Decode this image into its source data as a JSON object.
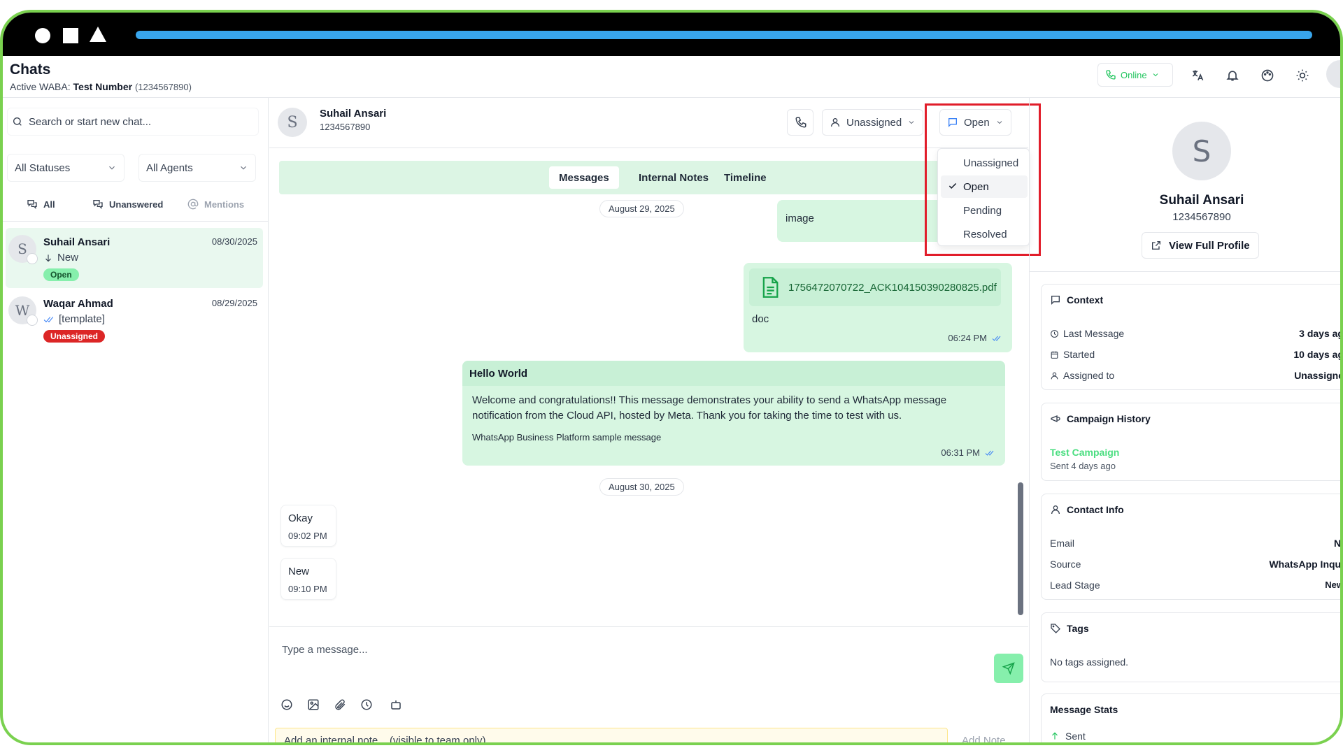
{
  "app": {
    "title": "Chats",
    "active_label": "Active WABA:",
    "active_name": "Test Number",
    "active_number": "(1234567890)",
    "status": "Online"
  },
  "sidebar": {
    "search_placeholder": "Search or start new chat...",
    "status_filter": "All Statuses",
    "agent_filter": "All Agents",
    "tabs": [
      "All",
      "Unanswered",
      "Mentions"
    ],
    "conversations": [
      {
        "initial": "S",
        "name": "Suhail Ansari",
        "date": "08/30/2025",
        "preview": "New",
        "badge": "Open"
      },
      {
        "initial": "W",
        "name": "Waqar Ahmad",
        "date": "08/29/2025",
        "preview": "[template]",
        "badge": "Unassigned"
      }
    ]
  },
  "chat": {
    "contact_initial": "S",
    "contact_name": "Suhail Ansari",
    "contact_phone": "1234567890",
    "assignee": "Unassigned",
    "status": "Open",
    "tabs": [
      "Messages",
      "Internal Notes",
      "Timeline"
    ],
    "dates": [
      "August 29, 2025",
      "August 30, 2025"
    ],
    "messages": {
      "image_caption": "image",
      "file_name": "1756472070722_ACK104150390280825.pdf",
      "file_caption": "doc",
      "file_time": "06:24 PM",
      "template_title": "Hello World",
      "template_body": "Welcome and congratulations!! This message demonstrates your ability to send a WhatsApp message notification from the Cloud API, hosted by Meta. Thank you for taking the time to test with us.",
      "template_footer": "WhatsApp Business Platform sample message",
      "template_time": "06:31 PM",
      "in1_text": "Okay",
      "in1_time": "09:02 PM",
      "in2_text": "New",
      "in2_time": "09:10 PM"
    },
    "composer_placeholder": "Type a message...",
    "note_placeholder": "Add an internal note... (visible to team only)",
    "add_note": "Add Note"
  },
  "status_dropdown": {
    "options": [
      "Unassigned",
      "Open",
      "Pending",
      "Resolved"
    ],
    "selected": "Open"
  },
  "profile": {
    "initial": "S",
    "name": "Suhail Ansari",
    "phone": "1234567890",
    "view_full": "View Full Profile",
    "context": {
      "title": "Context",
      "rows": [
        {
          "label": "Last Message",
          "value": "3 days ag"
        },
        {
          "label": "Started",
          "value": "10 days ag"
        },
        {
          "label": "Assigned to",
          "value": "Unassigne"
        }
      ]
    },
    "campaign": {
      "title": "Campaign History",
      "name": "Test Campaign",
      "sent": "Sent 4 days ago"
    },
    "contact_info": {
      "title": "Contact Info",
      "rows": [
        {
          "label": "Email",
          "value": "N/"
        },
        {
          "label": "Source",
          "value": "WhatsApp Inqui"
        },
        {
          "label": "Lead Stage",
          "value": "New"
        }
      ]
    },
    "tags": {
      "title": "Tags",
      "empty": "No tags assigned."
    },
    "stats": {
      "title": "Message Stats",
      "sent_label": "Sent"
    }
  },
  "colors": {
    "accent": "#22c55e",
    "frame": "#7ad14f",
    "progress": "#38a5ec",
    "highlight": "#e11d2a"
  }
}
